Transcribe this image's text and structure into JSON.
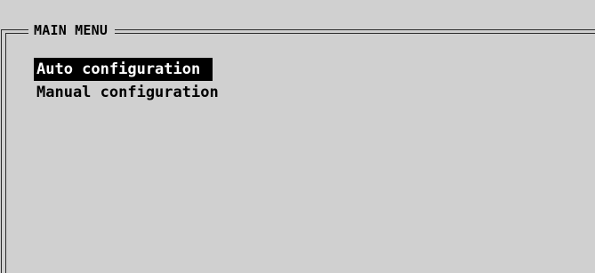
{
  "menu": {
    "title": "MAIN MENU",
    "items": [
      {
        "label": "Auto configuration",
        "selected": true
      },
      {
        "label": "Manual configuration",
        "selected": false
      }
    ]
  },
  "colors": {
    "background": "#d0d0d0",
    "frame": "#2a2a2a",
    "text": "#000000",
    "highlight_bg": "#000000",
    "highlight_text": "#ffffff"
  }
}
